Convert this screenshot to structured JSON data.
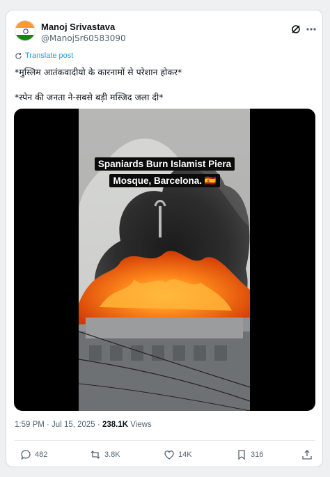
{
  "post": {
    "author_name": "Manoj Srivastava",
    "author_handle": "@ManojSr60583090",
    "translate_label": "Translate post",
    "text_line1": "*मुस्लिम आतंकवादीयो के कारनामों से परेशान होकर*",
    "text_line2": "*स्पेन की जनता ने-सबसे बड़ी मस्जिद जला दी*",
    "video_caption_line1": "Spaniards Burn Islamist Piera",
    "video_caption_line2": "Mosque, Barcelona. 🇪🇸",
    "timestamp": "1:59 PM · Jul 15, 2025 · ",
    "views_count": "238.1K",
    "views_label": " Views"
  },
  "actions": {
    "replies": "482",
    "reposts": "3.8K",
    "likes": "14K",
    "bookmarks": "316"
  },
  "icons": {
    "avatar": "india-flag-icon",
    "grok": "grok-icon",
    "more": "more-icon",
    "translate": "translate-icon",
    "reply": "reply-icon",
    "repost": "repost-icon",
    "like": "heart-icon",
    "bookmark": "bookmark-icon",
    "share": "share-icon"
  },
  "colors": {
    "link": "#1d9bf0",
    "secondary": "#536471",
    "fire": "#ff6a00"
  }
}
